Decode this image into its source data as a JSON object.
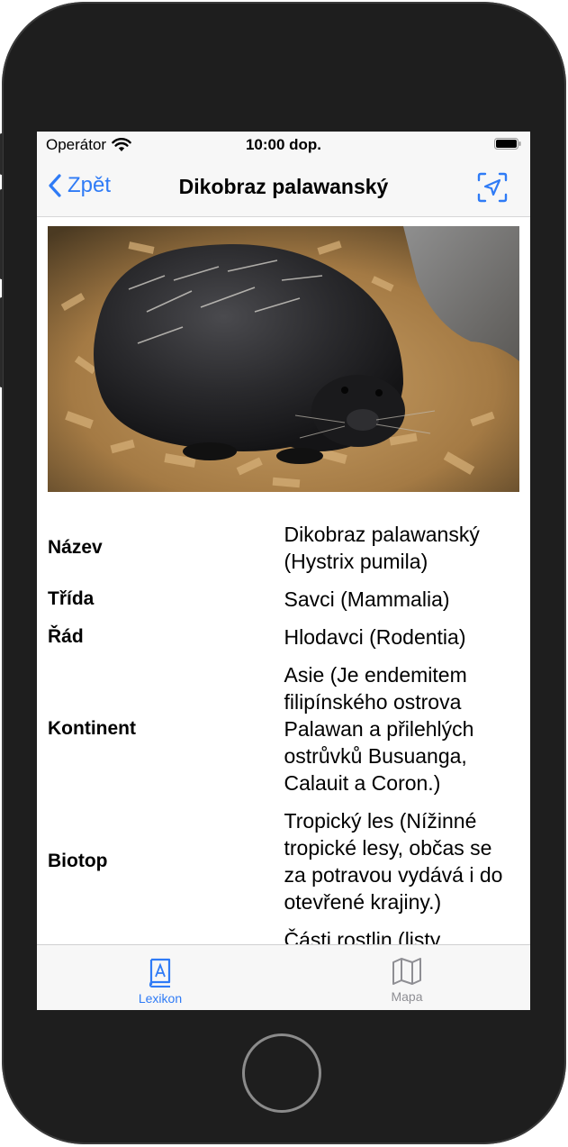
{
  "status_bar": {
    "carrier": "Operátor",
    "time": "10:00 dop."
  },
  "navbar": {
    "back_label": "Zpět",
    "title": "Dikobraz palawanský"
  },
  "photo": {
    "subject": "porcupine"
  },
  "details": [
    {
      "label": "Název",
      "value": "Dikobraz palawanský (Hystrix pumila)"
    },
    {
      "label": "Třída",
      "value": "Savci (Mammalia)"
    },
    {
      "label": "Řád",
      "value": "Hlodavci (Rodentia)"
    },
    {
      "label": "Kontinent",
      "value": "Asie (Je endemitem filipínského ostrova Palawan a přilehlých ostrůvků Busuanga, Calauit a Coron.)"
    },
    {
      "label": "Biotop",
      "value": "Tropický les (Nížinné tropické lesy, občas se za potravou vydává i do otevřené krajiny.)"
    },
    {
      "label": "",
      "value": "Části rostlin (listy,"
    }
  ],
  "tabbar": {
    "items": [
      {
        "label": "Lexikon",
        "icon": "book-icon",
        "active": true
      },
      {
        "label": "Mapa",
        "icon": "map-icon",
        "active": false
      }
    ]
  },
  "colors": {
    "accent": "#2F7BF6",
    "inactive": "#8E8E93",
    "bar_bg": "#F7F7F7"
  }
}
